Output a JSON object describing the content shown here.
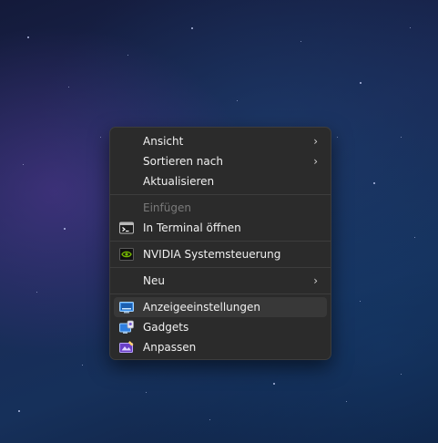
{
  "menu": {
    "items": [
      {
        "label": "Ansicht",
        "submenu": true
      },
      {
        "label": "Sortieren nach",
        "submenu": true
      },
      {
        "label": "Aktualisieren"
      },
      {
        "label": "Einfügen",
        "disabled": true
      },
      {
        "label": "In Terminal öffnen",
        "icon": "terminal-icon"
      },
      {
        "label": "NVIDIA Systemsteuerung",
        "icon": "nvidia-icon"
      },
      {
        "label": "Neu",
        "submenu": true
      },
      {
        "label": "Anzeigeeinstellungen",
        "icon": "display-settings-icon",
        "highlighted": true
      },
      {
        "label": "Gadgets",
        "icon": "gadgets-icon"
      },
      {
        "label": "Anpassen",
        "icon": "personalize-icon"
      }
    ],
    "chevron": "›"
  },
  "colors": {
    "menu_background": "#2b2b2b",
    "menu_border": "#3d3d3d",
    "text": "#f0f0f0",
    "disabled_text": "#7a7a7a",
    "hover_background": "#383838"
  }
}
